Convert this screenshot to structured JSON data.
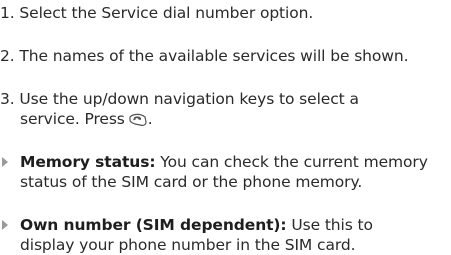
{
  "steps": [
    {
      "number": "1.",
      "text": "Select the Service dial number option."
    },
    {
      "number": "2.",
      "text": "The names of the available services will be shown."
    },
    {
      "number": "3.",
      "text_line1": "Use the up/down navigation keys to select a",
      "text_line2": "service. Press",
      "icon": "send-key-icon",
      "text_after": "."
    }
  ],
  "bullets": [
    {
      "term": "Memory status:",
      "text_line1": " You can check the current memory",
      "text_line2": "status of the SIM card or the phone memory."
    },
    {
      "term": "Own number (SIM dependent):",
      "text_line1": " Use this to",
      "text_line2": "display your phone number in the SIM card."
    }
  ],
  "colors": {
    "text": "#2a2a2a",
    "bullet_marker": "#9a9a9a"
  }
}
